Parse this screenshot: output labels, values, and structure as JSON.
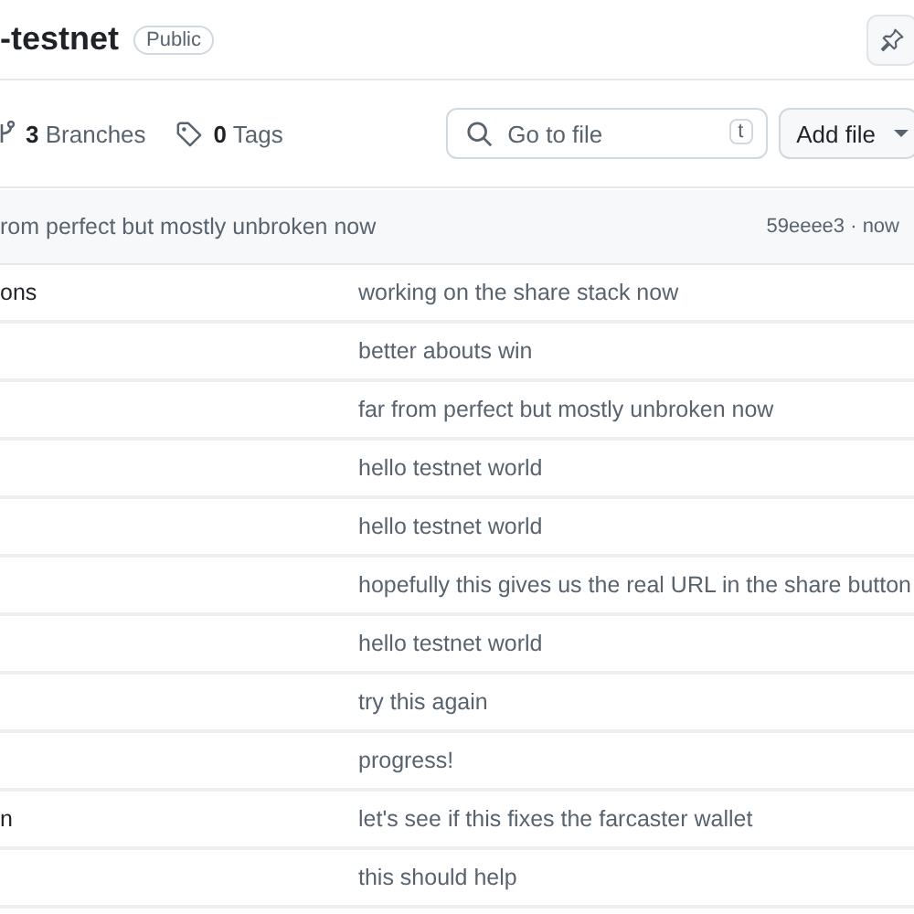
{
  "repo": {
    "title": "-testnet",
    "visibility": "Public"
  },
  "toolbar": {
    "branches_count": "3",
    "branches_label": "Branches",
    "tags_count": "0",
    "tags_label": "Tags",
    "search": {
      "placeholder": "Go to file",
      "shortcut": "t"
    },
    "add_button": "Add file"
  },
  "latest_commit": {
    "message": "rom perfect but mostly unbroken now",
    "hash": "59eeee3",
    "separator": "·",
    "time": "now"
  },
  "files": [
    {
      "name": "ons",
      "message": "working on the share stack now"
    },
    {
      "message": "better abouts win"
    },
    {
      "message": "far from perfect but mostly unbroken now"
    },
    {
      "message": "hello testnet world"
    },
    {
      "message": "hello testnet world"
    },
    {
      "message": "hopefully this gives us the real URL in the share button"
    },
    {
      "message": "hello testnet world"
    },
    {
      "message": "try this again"
    },
    {
      "message": "progress!"
    },
    {
      "name": "n",
      "message": "let's see if this fixes the farcaster wallet"
    },
    {
      "message": "this should help"
    }
  ]
}
